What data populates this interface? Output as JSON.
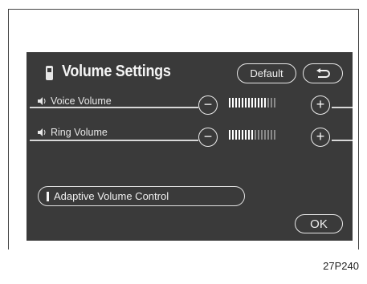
{
  "screen": {
    "title": "Volume Settings",
    "default_label": "Default",
    "back_icon": "back-arrow-icon"
  },
  "volume_rows": [
    {
      "label": "Voice Volume",
      "level_fraction": 0.8,
      "segments_on": 12,
      "segments_total": 15,
      "minus": "−",
      "plus": "+"
    },
    {
      "label": "Ring Volume",
      "level_fraction": 0.53,
      "segments_on": 8,
      "segments_total": 15,
      "minus": "−",
      "plus": "+"
    }
  ],
  "adaptive": {
    "label": "Adaptive Volume Control"
  },
  "ok_label": "OK",
  "figure_code": "27P240",
  "colors": {
    "screen_bg": "#3a3a3a",
    "foreground": "#f0f0f0",
    "bar_on": "#ffffff",
    "bar_off": "#8a8a8a"
  }
}
